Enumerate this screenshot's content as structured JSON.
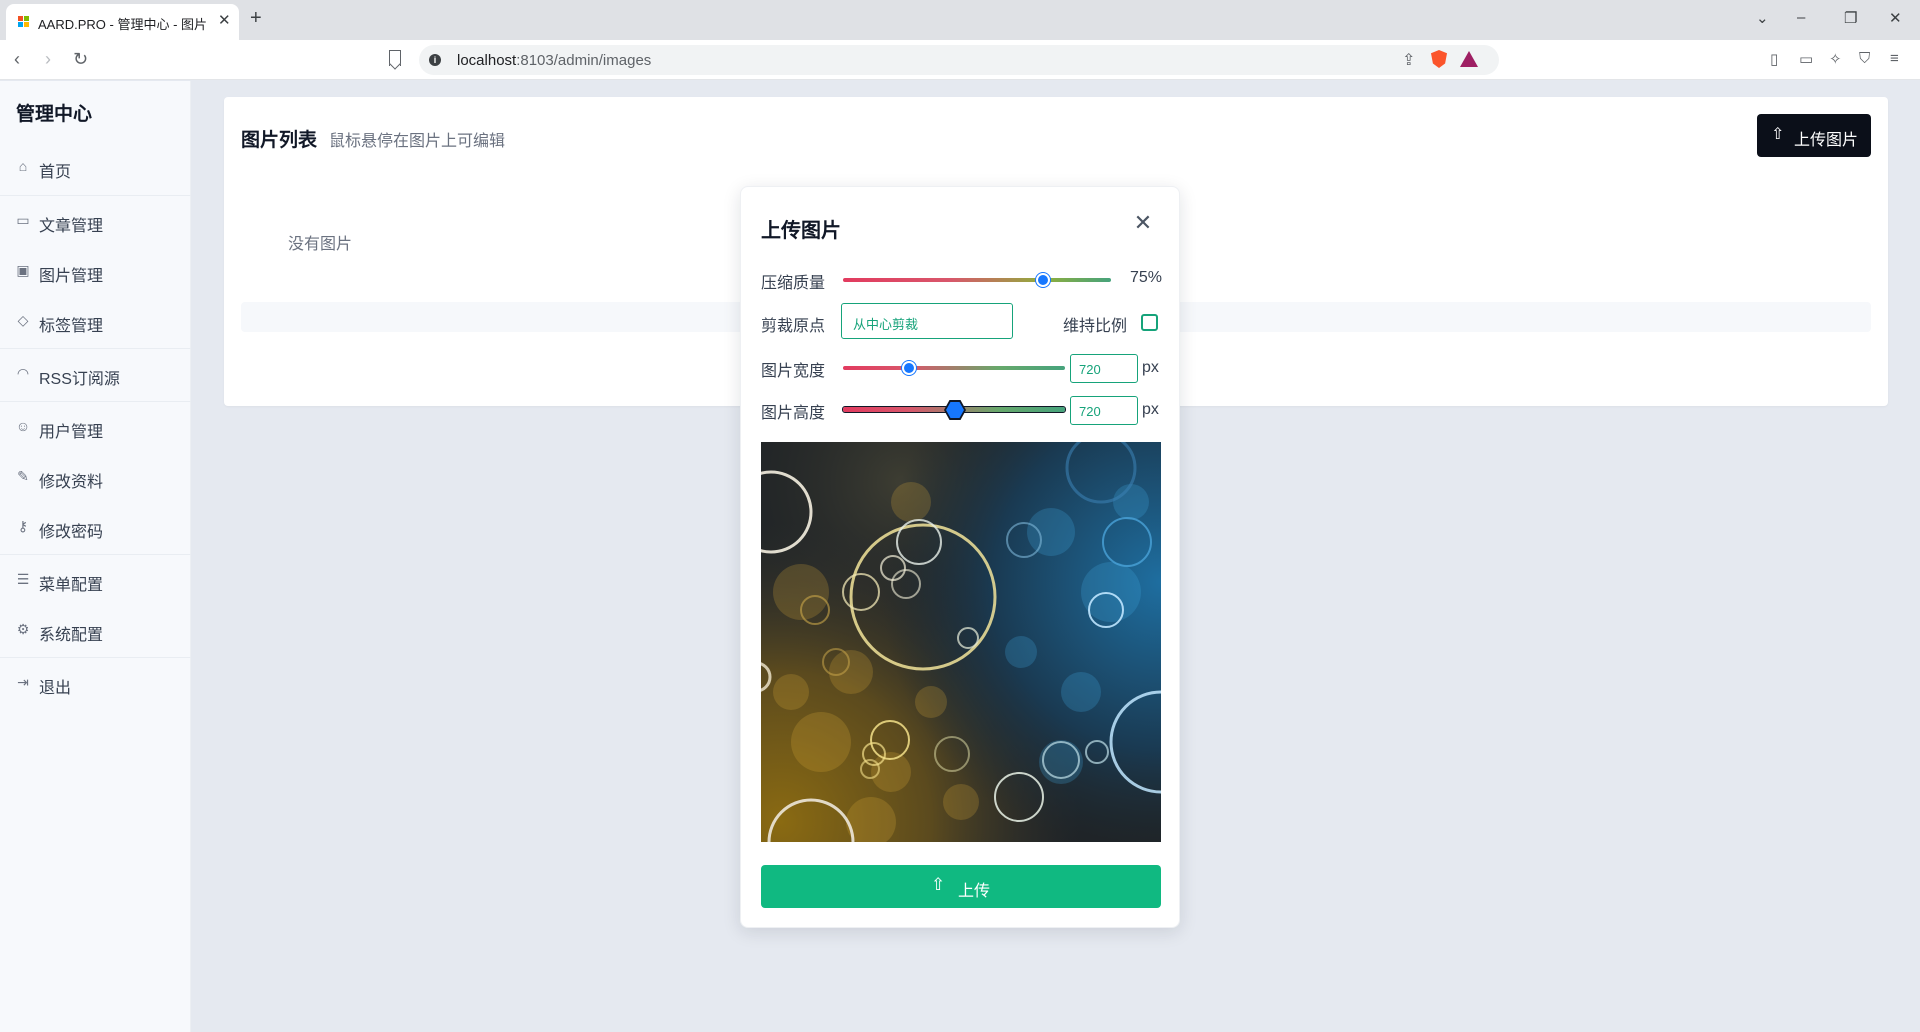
{
  "browser": {
    "tab_title": "AARD.PRO - 管理中心 - 图片",
    "tab_close": "✕",
    "new_tab": "+",
    "url_host": "localhost",
    "url_rest": ":8103/admin/images",
    "icons": [
      "back-icon",
      "forward-icon",
      "reload-icon",
      "bookmark-icon",
      "share-icon",
      "brave-shields-icon",
      "brave-rewards-icon",
      "sidebar-icon",
      "wallet-icon",
      "leo-icon",
      "vpn-icon",
      "menu-icon"
    ]
  },
  "sidebar": {
    "title": "管理中心",
    "items": [
      {
        "label": "首页",
        "icon": "home-icon"
      },
      {
        "label": "文章管理",
        "icon": "book-icon"
      },
      {
        "label": "图片管理",
        "icon": "image-icon"
      },
      {
        "label": "标签管理",
        "icon": "tag-icon"
      },
      {
        "label": "RSS订阅源",
        "icon": "rss-icon"
      },
      {
        "label": "用户管理",
        "icon": "users-icon"
      },
      {
        "label": "修改资料",
        "icon": "user-edit-icon"
      },
      {
        "label": "修改密码",
        "icon": "key-icon"
      },
      {
        "label": "菜单配置",
        "icon": "list-icon"
      },
      {
        "label": "系统配置",
        "icon": "gear-icon"
      },
      {
        "label": "退出",
        "icon": "logout-icon"
      }
    ]
  },
  "main": {
    "title": "图片列表",
    "hint": "鼠标悬停在图片上可编辑",
    "upload_button": "上传图片",
    "empty_text": "没有图片"
  },
  "modal": {
    "title": "上传图片",
    "quality_label": "压缩质量",
    "quality_value": "75%",
    "quality_fraction": 0.75,
    "crop_label": "剪裁原点",
    "crop_value": "从中心剪裁",
    "keep_ratio_label": "维持比例",
    "keep_ratio_checked": false,
    "width_label": "图片宽度",
    "width_value": "720",
    "height_label": "图片高度",
    "height_value": "720",
    "unit": "px",
    "submit_label": "上传"
  },
  "colors": {
    "accent": "#10b981",
    "slider_thumb": "#1677ff",
    "dark_button": "#0b0f19"
  }
}
